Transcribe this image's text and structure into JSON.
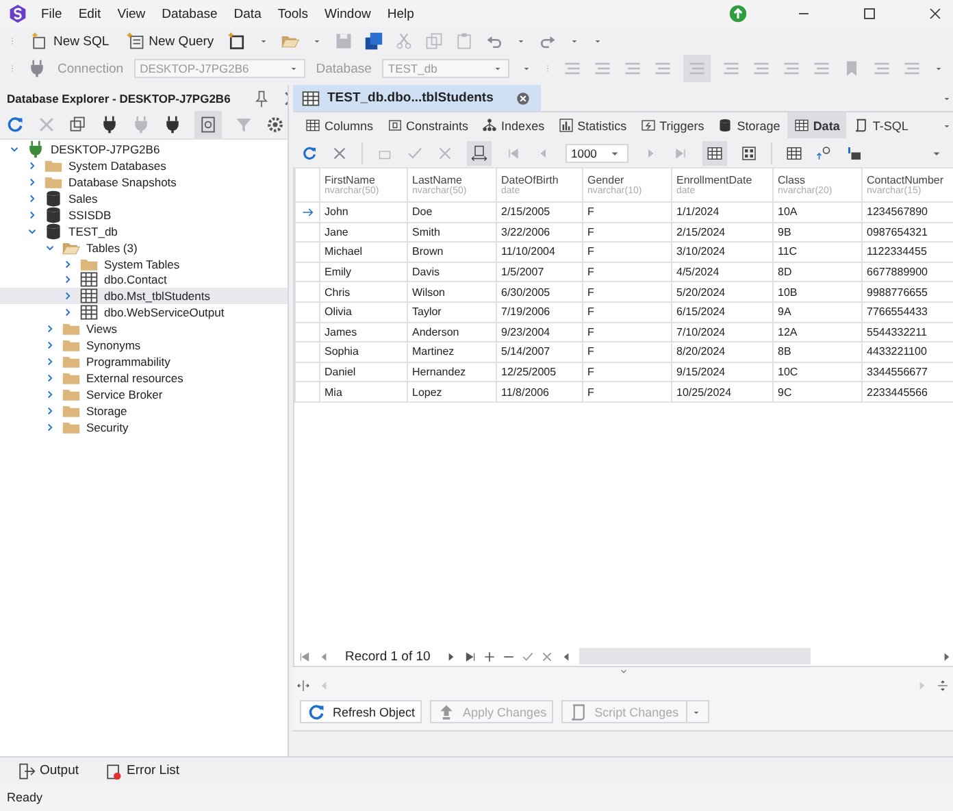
{
  "menu": [
    {
      "label": "File"
    },
    {
      "label": "Edit"
    },
    {
      "label": "View"
    },
    {
      "label": "Database"
    },
    {
      "label": "Data"
    },
    {
      "label": "Tools"
    },
    {
      "label": "Window"
    },
    {
      "label": "Help"
    }
  ],
  "toolbar": {
    "buttons": [
      {
        "label": "New SQL"
      },
      {
        "label": "New Query"
      }
    ]
  },
  "connection_bar": {
    "connection_label": "Connection",
    "connection_value": "DESKTOP-J7PG2B6",
    "database_label": "Database",
    "database_value": "TEST_db"
  },
  "explorer": {
    "title": "Database Explorer - DESKTOP-J7PG2B6",
    "tree": [
      {
        "label": "DESKTOP-J7PG2B6",
        "kind": "server",
        "expanded": true,
        "selected": false,
        "children": [
          {
            "label": "System Databases",
            "kind": "folder",
            "expanded": false,
            "selected": false
          },
          {
            "label": "Database Snapshots",
            "kind": "folder",
            "expanded": false,
            "selected": false
          },
          {
            "label": "Sales",
            "kind": "database",
            "expanded": false,
            "selected": false
          },
          {
            "label": "SSISDB",
            "kind": "database",
            "expanded": false,
            "selected": false
          },
          {
            "label": "TEST_db",
            "kind": "database",
            "expanded": true,
            "selected": false,
            "children": [
              {
                "label": "Tables (3)",
                "kind": "open-folder",
                "expanded": true,
                "selected": false,
                "children": [
                  {
                    "label": "System Tables",
                    "kind": "folder",
                    "expanded": false,
                    "selected": false
                  },
                  {
                    "label": "dbo.Contact",
                    "kind": "table",
                    "expanded": false,
                    "selected": false
                  },
                  {
                    "label": "dbo.Mst_tblStudents",
                    "kind": "table",
                    "expanded": false,
                    "selected": true
                  },
                  {
                    "label": "dbo.WebServiceOutput",
                    "kind": "table",
                    "expanded": false,
                    "selected": false
                  }
                ]
              },
              {
                "label": "Views",
                "kind": "folder",
                "expanded": false,
                "selected": false
              },
              {
                "label": "Synonyms",
                "kind": "folder",
                "expanded": false,
                "selected": false
              },
              {
                "label": "Programmability",
                "kind": "folder",
                "expanded": false,
                "selected": false
              },
              {
                "label": "External resources",
                "kind": "folder",
                "expanded": false,
                "selected": false
              },
              {
                "label": "Service Broker",
                "kind": "folder",
                "expanded": false,
                "selected": false
              },
              {
                "label": "Storage",
                "kind": "folder",
                "expanded": false,
                "selected": false
              },
              {
                "label": "Security",
                "kind": "folder",
                "expanded": false,
                "selected": false
              }
            ]
          }
        ]
      }
    ]
  },
  "document_tab": {
    "title": "TEST_db.dbo...tblStudents"
  },
  "object_tabs": [
    {
      "label": "Columns",
      "kind": "columns",
      "selected": false
    },
    {
      "label": "Constraints",
      "kind": "constraints",
      "selected": false
    },
    {
      "label": "Indexes",
      "kind": "indexes",
      "selected": false
    },
    {
      "label": "Statistics",
      "kind": "statistics",
      "selected": false
    },
    {
      "label": "Triggers",
      "kind": "triggers",
      "selected": false
    },
    {
      "label": "Storage",
      "kind": "storage",
      "selected": false
    },
    {
      "label": "Data",
      "kind": "data",
      "selected": true
    },
    {
      "label": "T-SQL",
      "kind": "tsql",
      "selected": false
    }
  ],
  "data_toolbar": {
    "row_limit": "1000"
  },
  "grid": {
    "columns": [
      {
        "name": "FirstName",
        "type": "nvarchar(50)"
      },
      {
        "name": "LastName",
        "type": "nvarchar(50)"
      },
      {
        "name": "DateOfBirth",
        "type": "date"
      },
      {
        "name": "Gender",
        "type": "nvarchar(10)"
      },
      {
        "name": "EnrollmentDate",
        "type": "date"
      },
      {
        "name": "Class",
        "type": "nvarchar(20)"
      },
      {
        "name": "ContactNumber",
        "type": "nvarchar(15)"
      }
    ],
    "rows": [
      {
        "selected": true,
        "cells": [
          "John",
          "Doe",
          "2/15/2005",
          "F",
          "1/1/2024",
          "10A",
          "1234567890"
        ]
      },
      {
        "selected": false,
        "cells": [
          "Jane",
          "Smith",
          "3/22/2006",
          "F",
          "2/15/2024",
          "9B",
          "0987654321"
        ]
      },
      {
        "selected": false,
        "cells": [
          "Michael",
          "Brown",
          "11/10/2004",
          "F",
          "3/10/2024",
          "11C",
          "1122334455"
        ]
      },
      {
        "selected": false,
        "cells": [
          "Emily",
          "Davis",
          "1/5/2007",
          "F",
          "4/5/2024",
          "8D",
          "6677889900"
        ]
      },
      {
        "selected": false,
        "cells": [
          "Chris",
          "Wilson",
          "6/30/2005",
          "F",
          "5/20/2024",
          "10B",
          "9988776655"
        ]
      },
      {
        "selected": false,
        "cells": [
          "Olivia",
          "Taylor",
          "7/19/2006",
          "F",
          "6/15/2024",
          "9A",
          "7766554433"
        ]
      },
      {
        "selected": false,
        "cells": [
          "James",
          "Anderson",
          "9/23/2004",
          "F",
          "7/10/2024",
          "12A",
          "5544332211"
        ]
      },
      {
        "selected": false,
        "cells": [
          "Sophia",
          "Martinez",
          "5/14/2007",
          "F",
          "8/20/2024",
          "8B",
          "4433221100"
        ]
      },
      {
        "selected": false,
        "cells": [
          "Daniel",
          "Hernandez",
          "12/25/2005",
          "F",
          "9/15/2024",
          "10C",
          "3344556677"
        ]
      },
      {
        "selected": false,
        "cells": [
          "Mia",
          "Lopez",
          "11/8/2006",
          "F",
          "10/25/2024",
          "9C",
          "2233445566"
        ]
      }
    ]
  },
  "navigator": {
    "record": "Record 1 of 10"
  },
  "action_buttons": [
    {
      "label": "Refresh Object",
      "kind": "refresh",
      "disabled": false,
      "dropdown": false
    },
    {
      "label": "Apply Changes",
      "kind": "apply",
      "disabled": true,
      "dropdown": false
    },
    {
      "label": "Script Changes",
      "kind": "script",
      "disabled": true,
      "dropdown": true
    }
  ],
  "bottom_tabs": [
    {
      "label": "Output",
      "kind": "output"
    },
    {
      "label": "Error List",
      "kind": "errors"
    }
  ],
  "status_bar": {
    "text": "Ready"
  }
}
